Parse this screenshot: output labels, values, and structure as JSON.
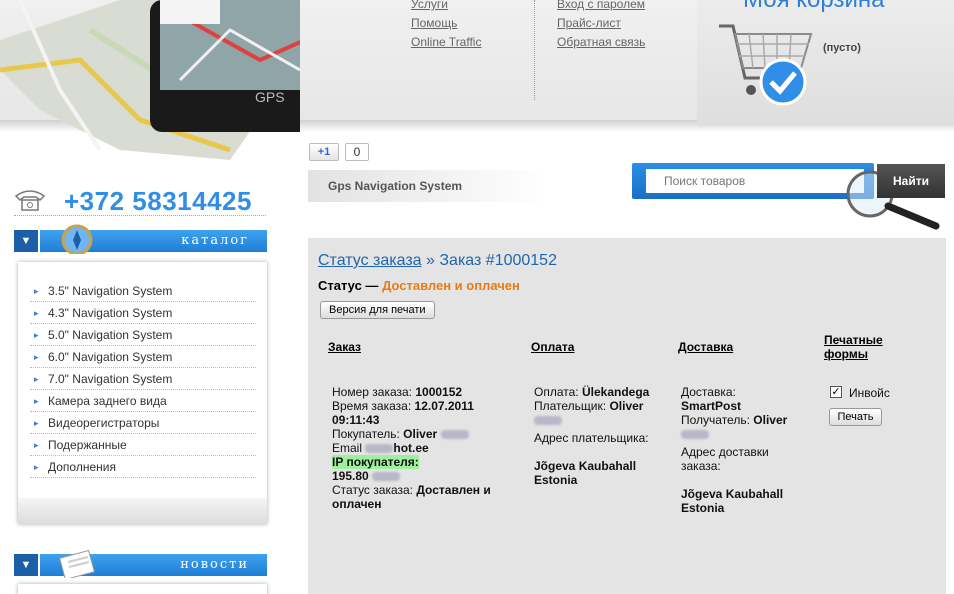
{
  "header": {
    "nav_col1": [
      "Услуги",
      "Помощь",
      "Online Traffic"
    ],
    "nav_col2": [
      "Вход с паролем",
      "Прайс-лист",
      "Обратная связь"
    ],
    "device_label": "GPS",
    "cart": {
      "title": "Моя корзина",
      "empty_label": "(пусто)"
    }
  },
  "sidebar": {
    "phone": "+372 58314425",
    "catalog_label": "каталог",
    "news_label": "новости",
    "menu_items": [
      "3.5\" Navigation System",
      "4.3\" Navigation System",
      "5.0\" Navigation System",
      "6.0\" Navigation System",
      "7.0\" Navigation System",
      "Камера заднего вида",
      "Видеорегистраторы",
      "Подержанные",
      "Дополнения"
    ]
  },
  "social": {
    "plusone_label": "+1",
    "plusone_count": "0"
  },
  "site_tag": "Gps Navigation System",
  "search": {
    "placeholder": "Поиск товаров",
    "button": "Найти"
  },
  "order": {
    "breadcrumb_link": "Статус заказа",
    "breadcrumb_sep": "»",
    "breadcrumb_current": "Заказ #1000152",
    "status_label": "Статус —",
    "status_value": "Доставлен и оплачен",
    "print_version_button": "Версия для печати",
    "columns": {
      "order": "Заказ",
      "payment": "Оплата",
      "delivery": "Доставка",
      "print_forms_1": "Печатные",
      "print_forms_2": "формы"
    },
    "details": {
      "number_label": "Номер заказа:",
      "number": "1000152",
      "time_label": "Время заказа:",
      "time": "12.07.2011 09:11:43",
      "buyer_label": "Покупатель:",
      "buyer": "Oliver",
      "email_label": "Email",
      "email_suffix": "hot.ee",
      "ip_label": "IP покупателя:",
      "ip": "195.80",
      "order_status_label": "Статус заказа:",
      "order_status": "Доставлен и оплачен"
    },
    "payment": {
      "method_label": "Оплата:",
      "method": "Ülekandega",
      "payer_label": "Плательщик:",
      "payer": "Oliver",
      "address_label": "Адрес плательщика:",
      "address_1": "Jõgeva Kaubahall",
      "address_2": "Estonia"
    },
    "delivery": {
      "method_label": "Доставка:",
      "method": "SmartPost",
      "recipient_label": "Получатель:",
      "recipient": "Oliver",
      "address_label": "Адрес доставки заказа:",
      "address_1": "Jõgeva Kaubahall",
      "address_2": "Estonia"
    },
    "print_forms": {
      "invoice_label": "Инвойс",
      "invoice_checked": true,
      "print_button": "Печать"
    }
  }
}
